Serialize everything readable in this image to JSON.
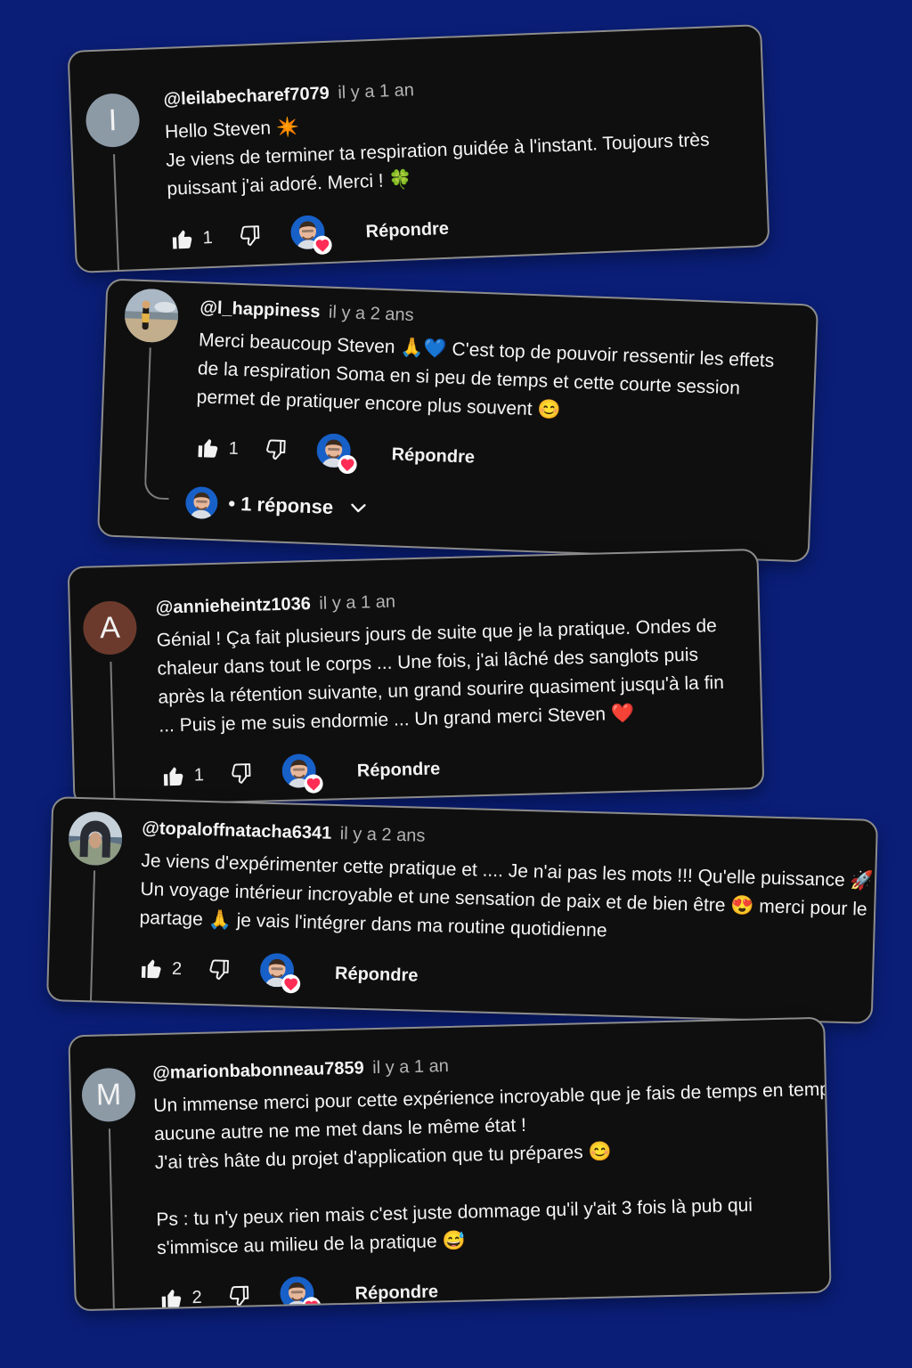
{
  "colors": {
    "page_background": "#0a1e78",
    "card_background": "#0f0f0f",
    "card_border": "#8c8c8c",
    "heart": "#ff2d55",
    "text_primary": "#f5f5f5",
    "text_secondary": "#b3b3b3"
  },
  "comments": [
    {
      "username": "@leilabecharef7079",
      "time": "il y a 1 an",
      "avatar_letter": "I",
      "avatar_color": "#8c9aa6",
      "lines": [
        "Hello Steven ✴️",
        "Je viens de terminer ta respiration guidée à l'instant. Toujours très",
        "puissant j'ai adoré. Merci ! 🍀"
      ],
      "likes": "1",
      "reply_label": "Répondre",
      "icons": [
        "like-icon",
        "dislike-icon",
        "creator-heart-icon"
      ]
    },
    {
      "username": "@l_happiness",
      "time": "il y a 2 ans",
      "avatar_kind": "photo",
      "lines": [
        "Merci beaucoup Steven 🙏💙 C'est top de pouvoir ressentir les effets",
        "de la respiration Soma en si peu de temps et cette courte session",
        "permet de pratiquer encore plus souvent 😊"
      ],
      "likes": "1",
      "reply_label": "Répondre",
      "replies_label": "• 1 réponse",
      "icons": [
        "like-icon",
        "dislike-icon",
        "creator-heart-icon",
        "chevron-down-icon"
      ]
    },
    {
      "username": "@annieheintz1036",
      "time": "il y a 1 an",
      "avatar_letter": "A",
      "avatar_color": "#6b3a2c",
      "lines": [
        "Génial ! Ça fait plusieurs jours de suite que je la pratique. Ondes de",
        "chaleur dans tout le corps ... Une fois, j'ai lâché des sanglots puis",
        "après la rétention suivante, un grand sourire quasiment jusqu'à la fin",
        "... Puis je me suis endormie ... Un grand merci Steven ❤️"
      ],
      "likes": "1",
      "reply_label": "Répondre",
      "icons": [
        "like-icon",
        "dislike-icon",
        "creator-heart-icon"
      ]
    },
    {
      "username": "@topaloffnatacha6341",
      "time": "il y a 2 ans",
      "avatar_kind": "photo",
      "lines": [
        "Je viens d'expérimenter cette pratique et .... Je n'ai pas les mots !!! Qu'elle puissance 🚀",
        "Un voyage intérieur incroyable et une sensation de paix et de bien être 😍 merci pour le",
        "partage 🙏 je vais l'intégrer dans ma routine quotidienne"
      ],
      "likes": "2",
      "reply_label": "Répondre",
      "icons": [
        "like-icon",
        "dislike-icon",
        "creator-heart-icon"
      ]
    },
    {
      "username": "@marionbabonneau7859",
      "time": "il y a 1 an",
      "avatar_letter": "M",
      "avatar_color": "#8c9aa6",
      "lines": [
        "Un immense merci pour cette expérience incroyable que je fais de temps en temps...",
        "aucune autre ne me met dans le même état !",
        "J'ai très hâte du projet d'application que tu prépares 😊",
        "",
        "Ps : tu n'y peux rien mais c'est juste dommage qu'il y'ait 3 fois là pub qui",
        "s'immisce au milieu de la pratique 😅"
      ],
      "likes": "2",
      "reply_label": "Répondre",
      "icons": [
        "like-icon",
        "dislike-icon",
        "creator-heart-icon"
      ]
    }
  ]
}
